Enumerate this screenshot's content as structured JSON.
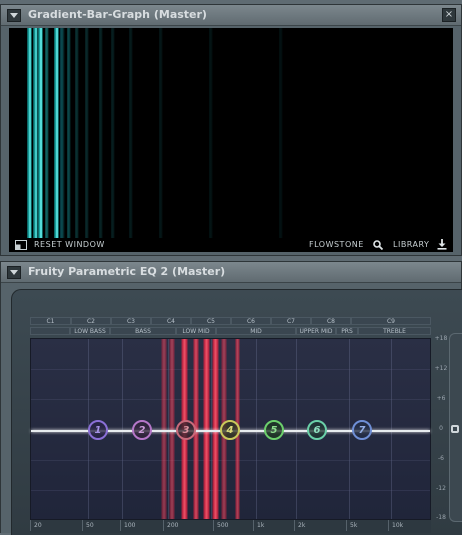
{
  "window1": {
    "title": "Gradient-Bar-Graph (Master)",
    "close_label": "×",
    "reset_label": "RESET WINDOW",
    "flowstone_label": "FLOWSTONE",
    "library_label": "LIBRARY",
    "icons": [
      "reset-window-icon",
      "search-icon",
      "download-icon"
    ]
  },
  "window2": {
    "title": "Fruity Parametric EQ 2 (Master)",
    "note_labels": [
      "C1",
      "C2",
      "C3",
      "C4",
      "C5",
      "C6",
      "C7",
      "C8",
      "C9"
    ],
    "range_labels": [
      "LOW BASS",
      "BASS",
      "LOW MID",
      "MID",
      "UPPER MID",
      "PRS",
      "TREBLE"
    ],
    "db_labels": [
      "+18",
      "+12",
      "+6",
      "0",
      "-6",
      "-12",
      "-18"
    ],
    "freq_labels": [
      "20",
      "50",
      "100",
      "200",
      "500",
      "1k",
      "2k",
      "5k",
      "10k"
    ],
    "bands": [
      "1",
      "2",
      "3",
      "4",
      "5",
      "6",
      "7"
    ],
    "band_colors": [
      "#8a6fd6",
      "#b577c9",
      "#c86a7a",
      "#c9c85a",
      "#6ccf6c",
      "#6ad0a8",
      "#6f8fd6"
    ]
  }
}
